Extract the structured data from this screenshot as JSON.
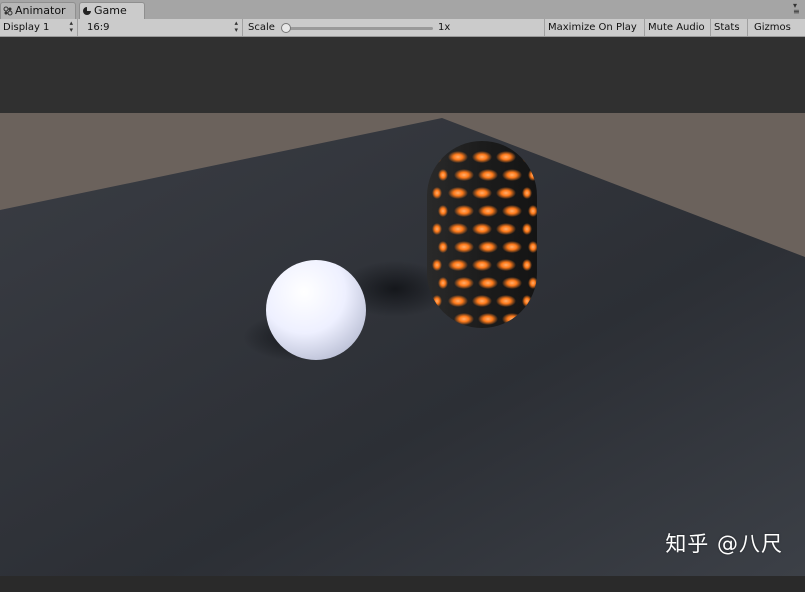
{
  "tabs": [
    {
      "label": "Animator",
      "icon": "animator-icon",
      "active": false
    },
    {
      "label": "Game",
      "icon": "game-icon",
      "active": true
    }
  ],
  "toolbar": {
    "display": "Display 1",
    "aspect": "16:9",
    "scale_label": "Scale",
    "scale_value": "1x",
    "maximize": "Maximize On Play",
    "mute": "Mute Audio",
    "stats": "Stats",
    "gizmos": "Gizmos"
  },
  "scene": {
    "objects": [
      "sphere",
      "capsule",
      "ground-plane"
    ],
    "sphere_color": "#f2f4ff",
    "capsule_color": "#1e1e1e",
    "capsule_glow_color": "#ff7a1a",
    "ground_color": "#3a3d44",
    "sky_color": "#6b625c"
  },
  "watermark": "知乎 @八尺"
}
